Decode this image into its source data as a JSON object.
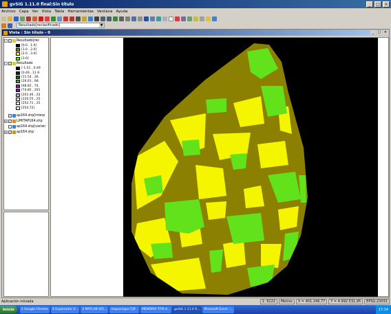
{
  "window": {
    "title": "gvSIG 1.11.0 final:Sin título",
    "min": "_",
    "max": "□",
    "close": "×"
  },
  "menu": [
    "Archivo",
    "Capa",
    "Ver",
    "Vista",
    "Tabla",
    "Herramientas",
    "Ventana",
    "Ayuda"
  ],
  "layer_combo": {
    "value": "Resultado[reclasificado]"
  },
  "view": {
    "title": "Vista : Sin título - 0"
  },
  "toc": {
    "layers": [
      {
        "name": "Resultado[rec",
        "visible": true,
        "expanded": true,
        "legend": [
          {
            "label": "[0.0 , 1.0]",
            "color": "#000000"
          },
          {
            "label": "[1.0 , 2.0]",
            "color": "#8b8000"
          },
          {
            "label": "[2.0 , 3.0]",
            "color": "#f5f500"
          },
          {
            "label": "[3.0]",
            "color": "#62e21a"
          }
        ]
      },
      {
        "name": "Resultado",
        "visible": true,
        "expanded": true,
        "legend": [
          {
            "label": "[-1.51 , 0.49",
            "color": "#000000"
          },
          {
            "label": "[0.49 , 11.9",
            "color": "#0b2e0b"
          },
          {
            "label": "[11.54 , 26.",
            "color": "#0f6b0f"
          },
          {
            "label": "[26.61 , 68.",
            "color": "#2bb02b"
          },
          {
            "label": "[68.82 , 74.",
            "color": "#7a1e7a"
          },
          {
            "label": "[74.85 , 201",
            "color": "#6a1fb0"
          },
          {
            "label": "[201.46 , 22",
            "color": "#c7a2e6"
          },
          {
            "label": "[220.55 , 25",
            "color": "#efe6f5"
          },
          {
            "label": "[252.71 , 25",
            "color": "#ffffff"
          },
          {
            "label": "[254.72]",
            "color": "#ffffff"
          }
        ]
      },
      {
        "name": "ap164.shp[interp",
        "visible": true,
        "expanded": false
      },
      {
        "name": "LIMITAP164.shp",
        "visible": true,
        "expanded": false
      },
      {
        "name": "ap164.shp[varian",
        "visible": false,
        "expanded": false
      },
      {
        "name": "ap164.shp",
        "visible": true,
        "expanded": false
      }
    ]
  },
  "status": {
    "message": "Aplicación iniciada",
    "scale": "1:  6222",
    "units": "Metros",
    "x": "X = 401.246,77",
    "y": "Y = 4.992.531,95",
    "epsg": "EPSG:23031"
  },
  "taskbar": {
    "start": "Inicio",
    "tasks": [
      "2 Google Chrome",
      "4 Explorador d...",
      "2 MATLAB (R2...",
      "mapasvigor.T.JP...",
      "MEMORIA TFM.d...",
      "gvSIG 1.11.0 fi...",
      "Microsoft Excel -..."
    ],
    "active_index": 5,
    "clock": "17:14"
  }
}
